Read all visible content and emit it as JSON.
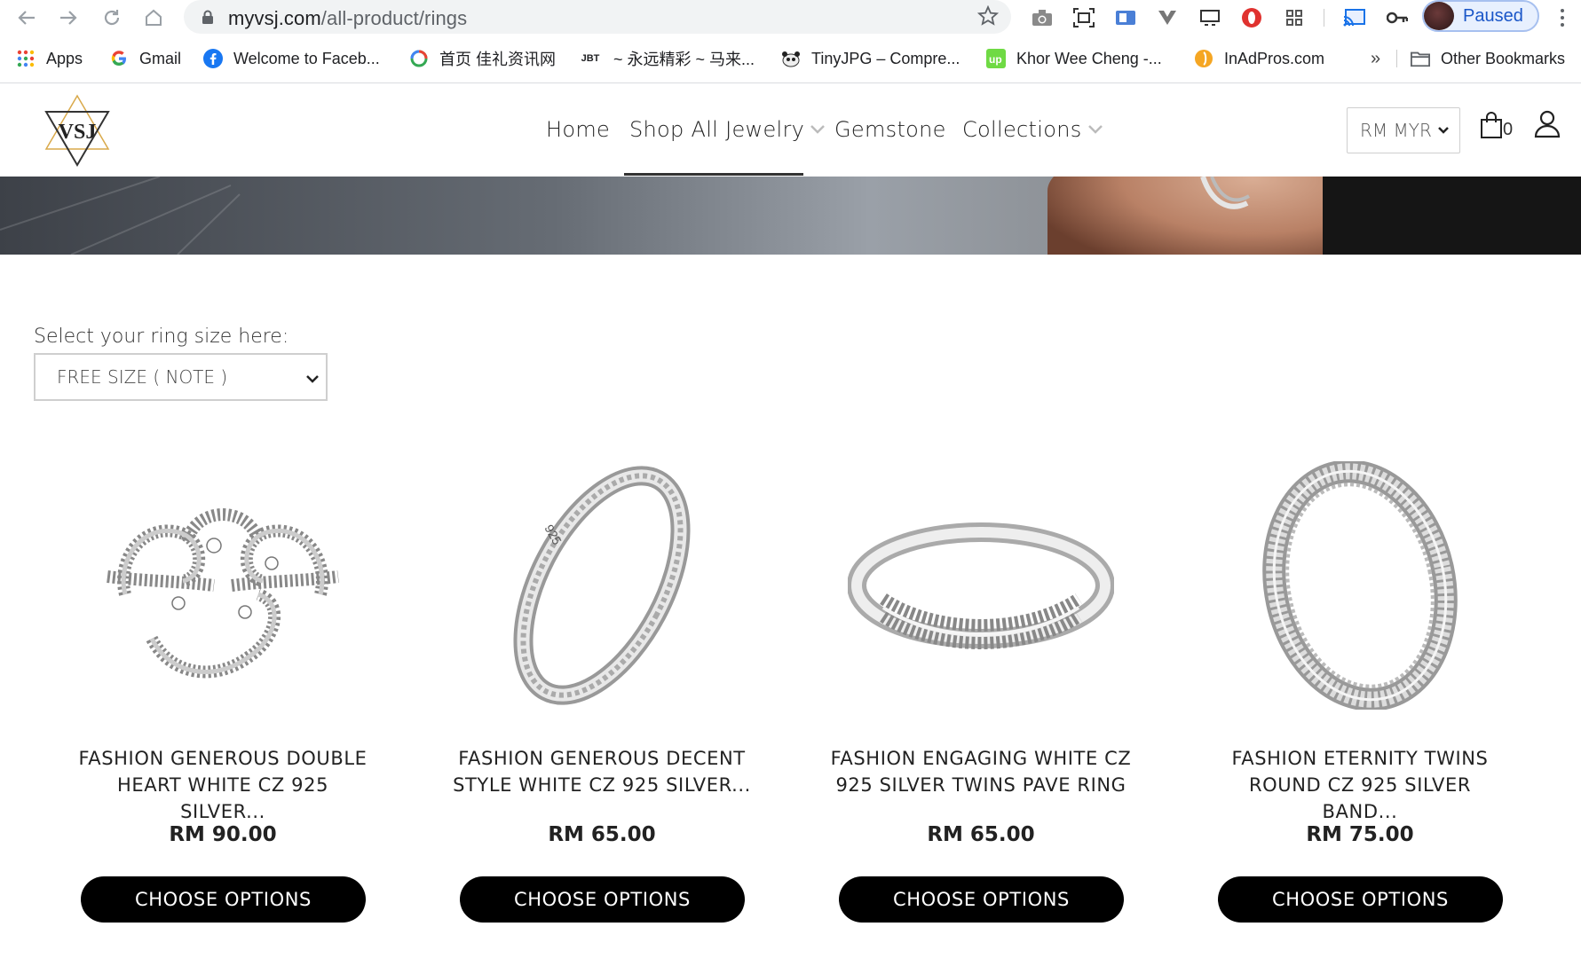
{
  "browser": {
    "url_host": "myvsj.com",
    "url_path": "/all-product/rings",
    "profile_status": "Paused",
    "extensions": [
      "camera-icon",
      "screenshot-icon",
      "extension-blue-icon",
      "vivaldi-icon",
      "cast-tab-icon",
      "opera-icon",
      "grid-icon",
      "cast-icon",
      "key-icon"
    ]
  },
  "bookmarks": {
    "items": [
      {
        "label": "Apps",
        "icon": "apps-grid-icon"
      },
      {
        "label": "Gmail",
        "icon": "google-icon"
      },
      {
        "label": "Welcome to Faceb...",
        "icon": "facebook-icon"
      },
      {
        "label": "首页 佳礼资讯网",
        "icon": "jiali-icon"
      },
      {
        "label": "~ 永远精彩 ~ 马来...",
        "icon": "jbt-icon"
      },
      {
        "label": "TinyJPG – Compre...",
        "icon": "panda-icon"
      },
      {
        "label": "Khor Wee Cheng -...",
        "icon": "upwork-icon"
      },
      {
        "label": "InAdPros.com",
        "icon": "inadpros-icon"
      }
    ],
    "overflow": "»",
    "other": "Other Bookmarks"
  },
  "site": {
    "logo_text": "VSJ",
    "nav": [
      {
        "label": "Home"
      },
      {
        "label": "Shop All Jewelry",
        "dropdown": true,
        "active": true
      },
      {
        "label": "Gemstone"
      },
      {
        "label": "Collections",
        "dropdown": true
      }
    ],
    "currency": "RM MYR",
    "cart_count": "0"
  },
  "filter": {
    "label": "Select your ring size here:",
    "value": "FREE SIZE ( NOTE )"
  },
  "products": [
    {
      "name_line1": "FASHION GENEROUS DOUBLE",
      "name_line2": "HEART WHITE CZ 925 SILVER...",
      "price": "RM 90.00",
      "button": "CHOOSE OPTIONS"
    },
    {
      "name_line1": "FASHION GENEROUS DECENT",
      "name_line2": "STYLE WHITE CZ 925 SILVER...",
      "price": "RM 65.00",
      "button": "CHOOSE OPTIONS"
    },
    {
      "name_line1": "FASHION ENGAGING WHITE CZ",
      "name_line2": "925 SILVER TWINS PAVE RING",
      "price": "RM 65.00",
      "button": "CHOOSE OPTIONS"
    },
    {
      "name_line1": "FASHION ETERNITY TWINS",
      "name_line2": "ROUND CZ 925 SILVER BAND...",
      "price": "RM 75.00",
      "button": "CHOOSE OPTIONS"
    }
  ],
  "colors": {
    "accent": "#000000",
    "profile_blue": "#1a56c8"
  }
}
